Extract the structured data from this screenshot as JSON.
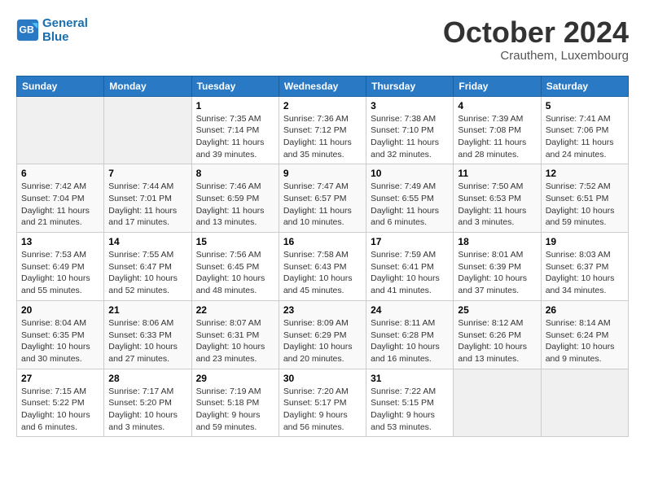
{
  "header": {
    "logo_line1": "General",
    "logo_line2": "Blue",
    "month": "October 2024",
    "location": "Crauthem, Luxembourg"
  },
  "days_of_week": [
    "Sunday",
    "Monday",
    "Tuesday",
    "Wednesday",
    "Thursday",
    "Friday",
    "Saturday"
  ],
  "weeks": [
    [
      {
        "day": "",
        "info": ""
      },
      {
        "day": "",
        "info": ""
      },
      {
        "day": "1",
        "sunrise": "Sunrise: 7:35 AM",
        "sunset": "Sunset: 7:14 PM",
        "daylight": "Daylight: 11 hours and 39 minutes."
      },
      {
        "day": "2",
        "sunrise": "Sunrise: 7:36 AM",
        "sunset": "Sunset: 7:12 PM",
        "daylight": "Daylight: 11 hours and 35 minutes."
      },
      {
        "day": "3",
        "sunrise": "Sunrise: 7:38 AM",
        "sunset": "Sunset: 7:10 PM",
        "daylight": "Daylight: 11 hours and 32 minutes."
      },
      {
        "day": "4",
        "sunrise": "Sunrise: 7:39 AM",
        "sunset": "Sunset: 7:08 PM",
        "daylight": "Daylight: 11 hours and 28 minutes."
      },
      {
        "day": "5",
        "sunrise": "Sunrise: 7:41 AM",
        "sunset": "Sunset: 7:06 PM",
        "daylight": "Daylight: 11 hours and 24 minutes."
      }
    ],
    [
      {
        "day": "6",
        "sunrise": "Sunrise: 7:42 AM",
        "sunset": "Sunset: 7:04 PM",
        "daylight": "Daylight: 11 hours and 21 minutes."
      },
      {
        "day": "7",
        "sunrise": "Sunrise: 7:44 AM",
        "sunset": "Sunset: 7:01 PM",
        "daylight": "Daylight: 11 hours and 17 minutes."
      },
      {
        "day": "8",
        "sunrise": "Sunrise: 7:46 AM",
        "sunset": "Sunset: 6:59 PM",
        "daylight": "Daylight: 11 hours and 13 minutes."
      },
      {
        "day": "9",
        "sunrise": "Sunrise: 7:47 AM",
        "sunset": "Sunset: 6:57 PM",
        "daylight": "Daylight: 11 hours and 10 minutes."
      },
      {
        "day": "10",
        "sunrise": "Sunrise: 7:49 AM",
        "sunset": "Sunset: 6:55 PM",
        "daylight": "Daylight: 11 hours and 6 minutes."
      },
      {
        "day": "11",
        "sunrise": "Sunrise: 7:50 AM",
        "sunset": "Sunset: 6:53 PM",
        "daylight": "Daylight: 11 hours and 3 minutes."
      },
      {
        "day": "12",
        "sunrise": "Sunrise: 7:52 AM",
        "sunset": "Sunset: 6:51 PM",
        "daylight": "Daylight: 10 hours and 59 minutes."
      }
    ],
    [
      {
        "day": "13",
        "sunrise": "Sunrise: 7:53 AM",
        "sunset": "Sunset: 6:49 PM",
        "daylight": "Daylight: 10 hours and 55 minutes."
      },
      {
        "day": "14",
        "sunrise": "Sunrise: 7:55 AM",
        "sunset": "Sunset: 6:47 PM",
        "daylight": "Daylight: 10 hours and 52 minutes."
      },
      {
        "day": "15",
        "sunrise": "Sunrise: 7:56 AM",
        "sunset": "Sunset: 6:45 PM",
        "daylight": "Daylight: 10 hours and 48 minutes."
      },
      {
        "day": "16",
        "sunrise": "Sunrise: 7:58 AM",
        "sunset": "Sunset: 6:43 PM",
        "daylight": "Daylight: 10 hours and 45 minutes."
      },
      {
        "day": "17",
        "sunrise": "Sunrise: 7:59 AM",
        "sunset": "Sunset: 6:41 PM",
        "daylight": "Daylight: 10 hours and 41 minutes."
      },
      {
        "day": "18",
        "sunrise": "Sunrise: 8:01 AM",
        "sunset": "Sunset: 6:39 PM",
        "daylight": "Daylight: 10 hours and 37 minutes."
      },
      {
        "day": "19",
        "sunrise": "Sunrise: 8:03 AM",
        "sunset": "Sunset: 6:37 PM",
        "daylight": "Daylight: 10 hours and 34 minutes."
      }
    ],
    [
      {
        "day": "20",
        "sunrise": "Sunrise: 8:04 AM",
        "sunset": "Sunset: 6:35 PM",
        "daylight": "Daylight: 10 hours and 30 minutes."
      },
      {
        "day": "21",
        "sunrise": "Sunrise: 8:06 AM",
        "sunset": "Sunset: 6:33 PM",
        "daylight": "Daylight: 10 hours and 27 minutes."
      },
      {
        "day": "22",
        "sunrise": "Sunrise: 8:07 AM",
        "sunset": "Sunset: 6:31 PM",
        "daylight": "Daylight: 10 hours and 23 minutes."
      },
      {
        "day": "23",
        "sunrise": "Sunrise: 8:09 AM",
        "sunset": "Sunset: 6:29 PM",
        "daylight": "Daylight: 10 hours and 20 minutes."
      },
      {
        "day": "24",
        "sunrise": "Sunrise: 8:11 AM",
        "sunset": "Sunset: 6:28 PM",
        "daylight": "Daylight: 10 hours and 16 minutes."
      },
      {
        "day": "25",
        "sunrise": "Sunrise: 8:12 AM",
        "sunset": "Sunset: 6:26 PM",
        "daylight": "Daylight: 10 hours and 13 minutes."
      },
      {
        "day": "26",
        "sunrise": "Sunrise: 8:14 AM",
        "sunset": "Sunset: 6:24 PM",
        "daylight": "Daylight: 10 hours and 9 minutes."
      }
    ],
    [
      {
        "day": "27",
        "sunrise": "Sunrise: 7:15 AM",
        "sunset": "Sunset: 5:22 PM",
        "daylight": "Daylight: 10 hours and 6 minutes."
      },
      {
        "day": "28",
        "sunrise": "Sunrise: 7:17 AM",
        "sunset": "Sunset: 5:20 PM",
        "daylight": "Daylight: 10 hours and 3 minutes."
      },
      {
        "day": "29",
        "sunrise": "Sunrise: 7:19 AM",
        "sunset": "Sunset: 5:18 PM",
        "daylight": "Daylight: 9 hours and 59 minutes."
      },
      {
        "day": "30",
        "sunrise": "Sunrise: 7:20 AM",
        "sunset": "Sunset: 5:17 PM",
        "daylight": "Daylight: 9 hours and 56 minutes."
      },
      {
        "day": "31",
        "sunrise": "Sunrise: 7:22 AM",
        "sunset": "Sunset: 5:15 PM",
        "daylight": "Daylight: 9 hours and 53 minutes."
      },
      {
        "day": "",
        "info": ""
      },
      {
        "day": "",
        "info": ""
      }
    ]
  ]
}
